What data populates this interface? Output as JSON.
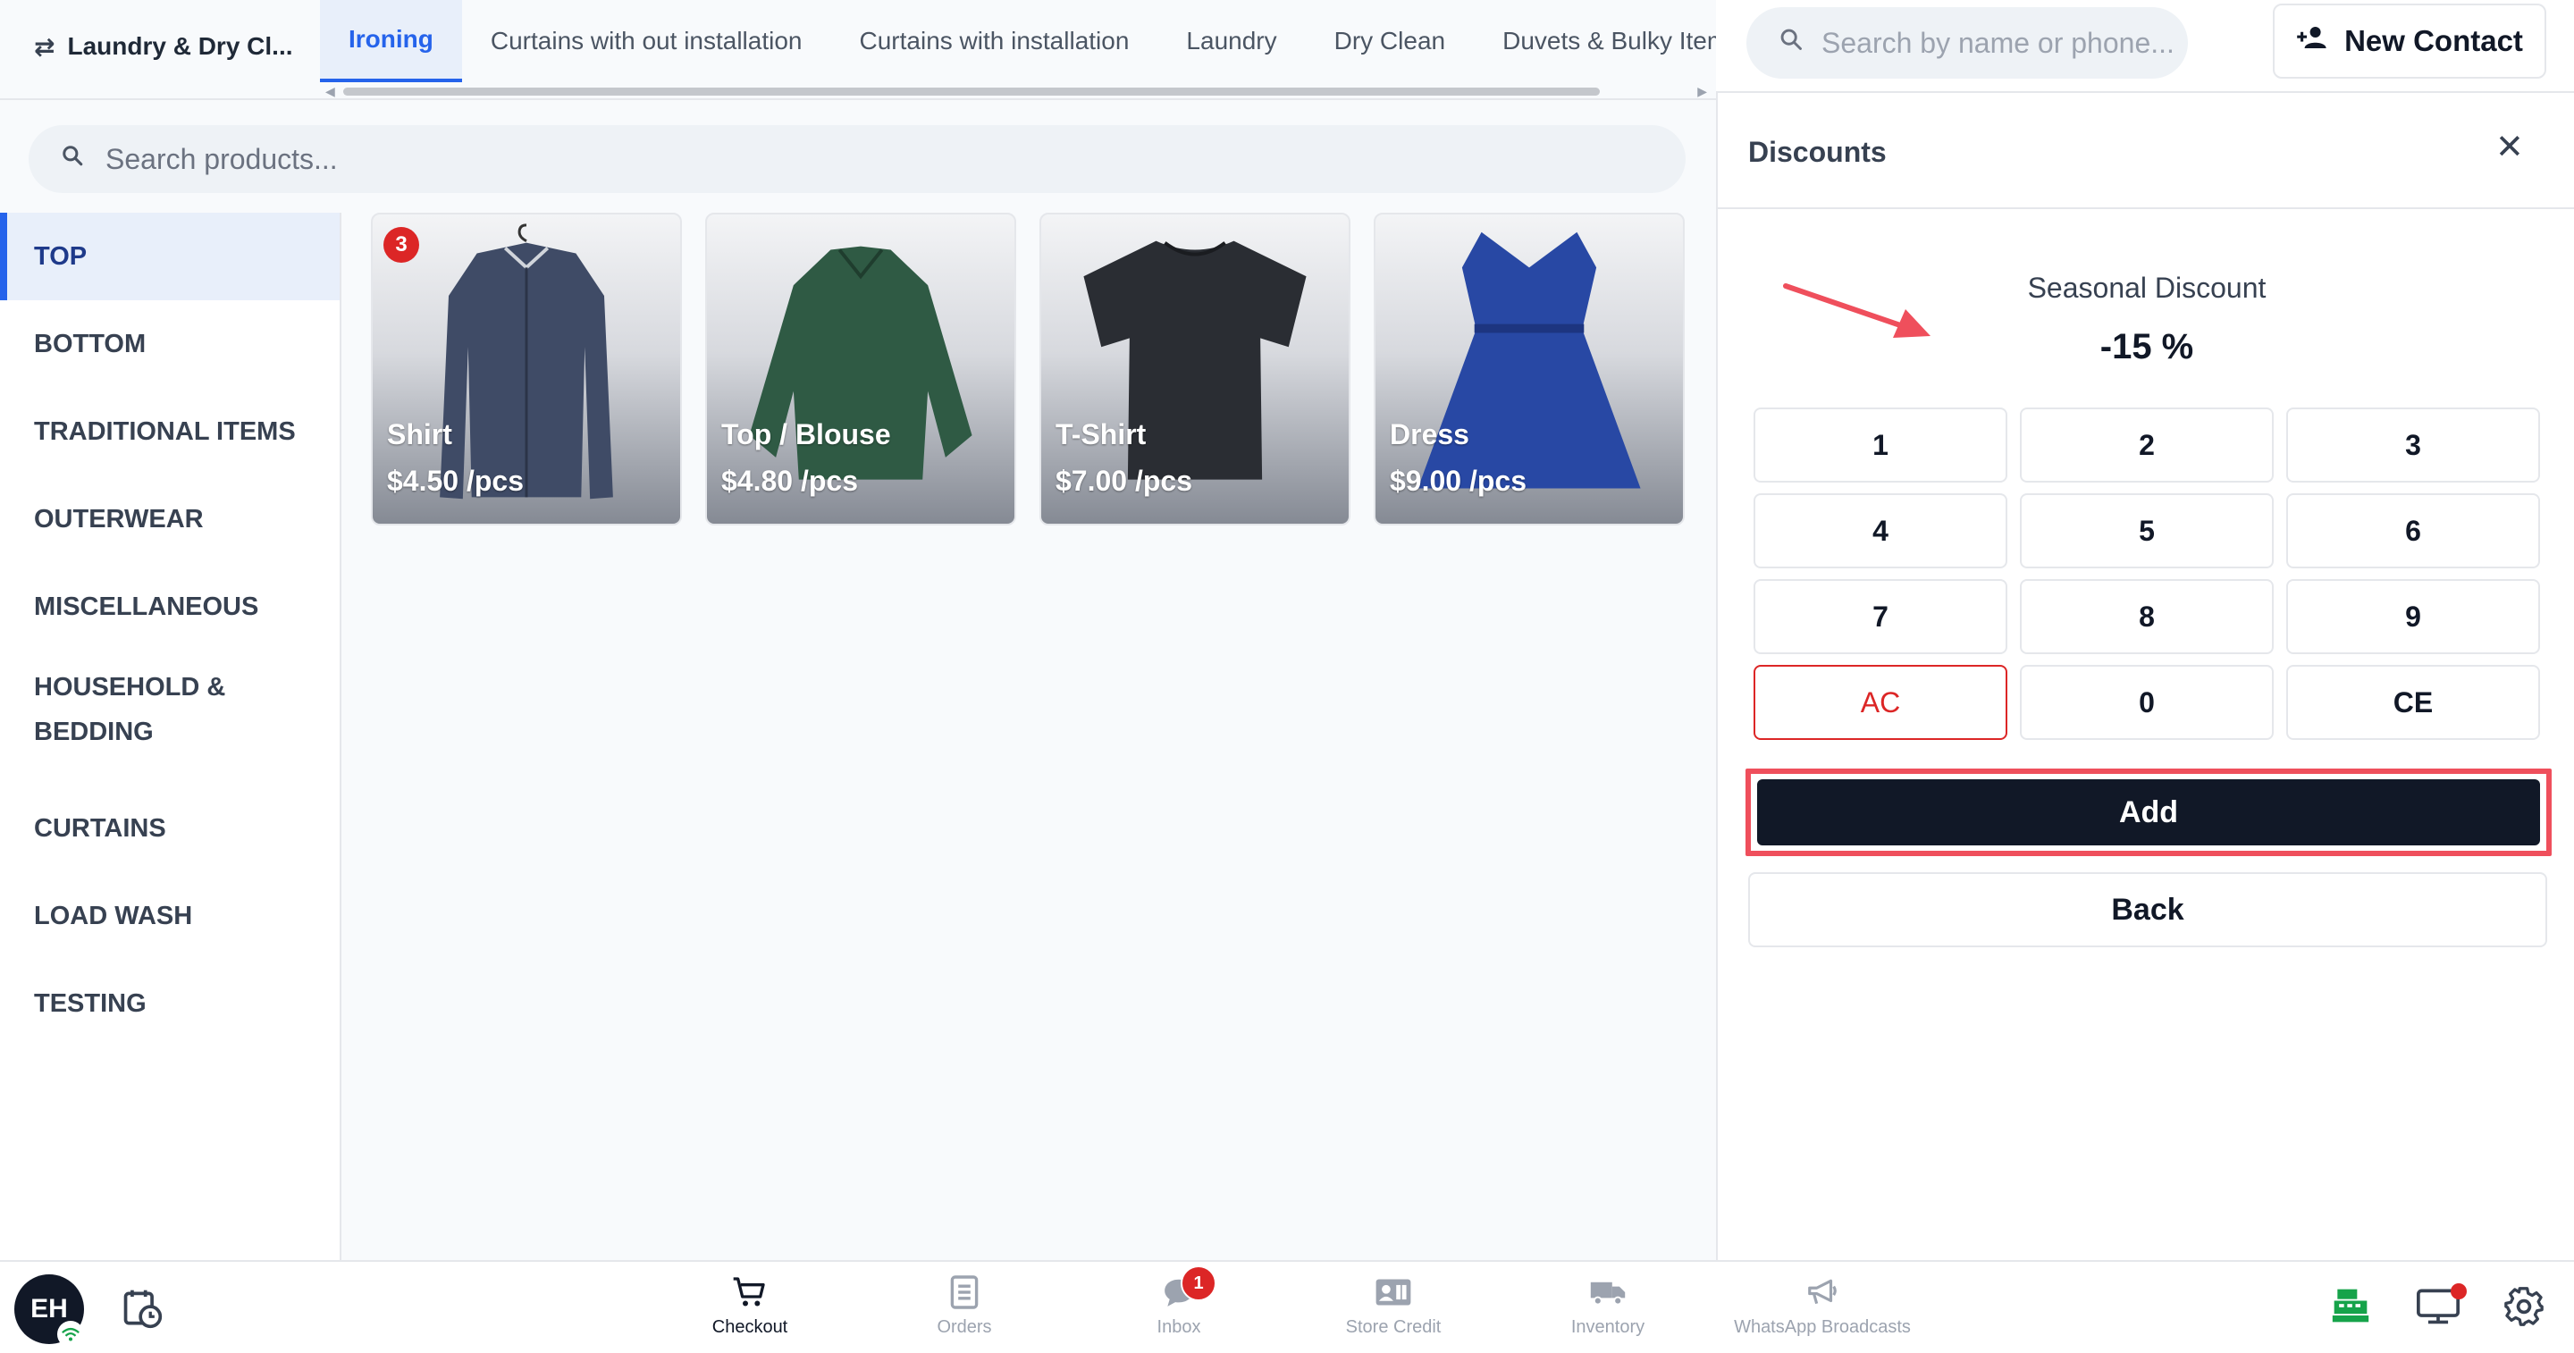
{
  "store": {
    "name": "Laundry & Dry Cl...",
    "switch_icon": "swap-arrows-icon"
  },
  "tabs": [
    {
      "label": "Ironing",
      "active": true
    },
    {
      "label": "Curtains with out installation"
    },
    {
      "label": "Curtains with installation"
    },
    {
      "label": "Laundry"
    },
    {
      "label": "Dry Clean"
    },
    {
      "label": "Duvets & Bulky Items"
    }
  ],
  "contact_search": {
    "placeholder": "Search by name or phone..."
  },
  "new_contact": {
    "label": "New Contact",
    "icon": "add-person-icon"
  },
  "product_search": {
    "placeholder": "Search products..."
  },
  "categories": [
    {
      "label": "TOP",
      "active": true
    },
    {
      "label": "BOTTOM"
    },
    {
      "label": "TRADITIONAL ITEMS"
    },
    {
      "label": "OUTERWEAR"
    },
    {
      "label": "MISCELLANEOUS"
    },
    {
      "label": "HOUSEHOLD & BEDDING"
    },
    {
      "label": "CURTAINS"
    },
    {
      "label": "LOAD WASH"
    },
    {
      "label": "TESTING"
    }
  ],
  "products": [
    {
      "name": "Shirt",
      "price": "$4.50 /pcs",
      "count": "3"
    },
    {
      "name": "Top / Blouse",
      "price": "$4.80 /pcs"
    },
    {
      "name": "T-Shirt",
      "price": "$7.00 /pcs"
    },
    {
      "name": "Dress",
      "price": "$9.00 /pcs"
    }
  ],
  "discounts": {
    "title": "Discounts",
    "discount_name": "Seasonal Discount",
    "discount_value": "-15 %",
    "keys": [
      "1",
      "2",
      "3",
      "4",
      "5",
      "6",
      "7",
      "8",
      "9",
      "AC",
      "0",
      "CE"
    ],
    "add_label": "Add",
    "back_label": "Back"
  },
  "bottom_nav": {
    "avatar_initials": "EH",
    "items": [
      {
        "label": "Checkout",
        "active": true
      },
      {
        "label": "Orders"
      },
      {
        "label": "Inbox",
        "badge": "1"
      },
      {
        "label": "Store Credit"
      },
      {
        "label": "Inventory"
      },
      {
        "label": "WhatsApp Broadcasts"
      }
    ]
  },
  "colors": {
    "accent": "#2563eb",
    "primary_button": "#111827",
    "highlight": "#ef4f5c",
    "badge": "#dc2626"
  }
}
